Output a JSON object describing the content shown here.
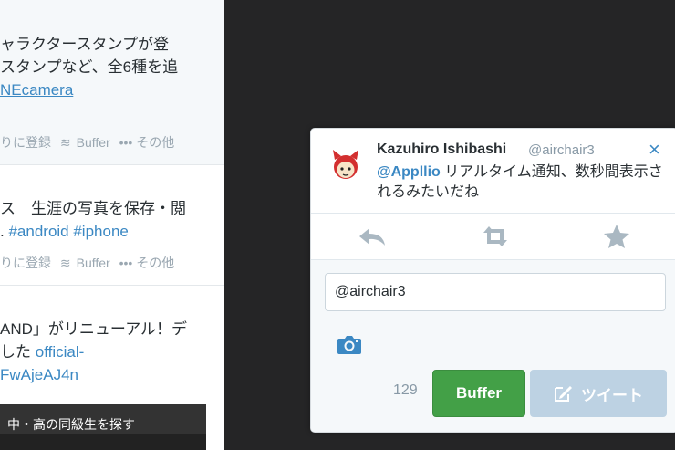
{
  "timeline": {
    "tweets": [
      {
        "lines": [
          "ャラクタースタンプが登",
          "スタンプなど、全6種を追"
        ],
        "link": "NEcamera",
        "actions": {
          "favorite": "りに登録",
          "buffer": "Buffer",
          "more": "••• その他"
        }
      },
      {
        "line": "ス　生涯の写真を保存・閲",
        "prefix": ".",
        "tags": "#android #iphone",
        "actions": {
          "favorite": "りに登録",
          "buffer": "Buffer",
          "more": "••• その他"
        }
      },
      {
        "line1": "AND」がリニューアル！デ",
        "line2_text": "した ",
        "line2_link": "official-",
        "line3_link": "FwAjeAJ4n",
        "embed_label": "中・高の同級生を探す"
      }
    ]
  },
  "popup": {
    "author_name": "Kazuhiro Ishibashi",
    "author_handle": "@airchair3",
    "close_icon": "×",
    "mention": "@Appllio",
    "tweet_text": " リアルタイム通知、数秒間表示されるみたいだね",
    "reply_input_value": "@airchair3",
    "char_count": "129",
    "buffer_label": "Buffer",
    "tweet_label": "ツイート",
    "colors": {
      "accent": "#3b88c3",
      "buffer_green": "#43a047",
      "tweet_disabled": "#bdd2e3"
    }
  }
}
